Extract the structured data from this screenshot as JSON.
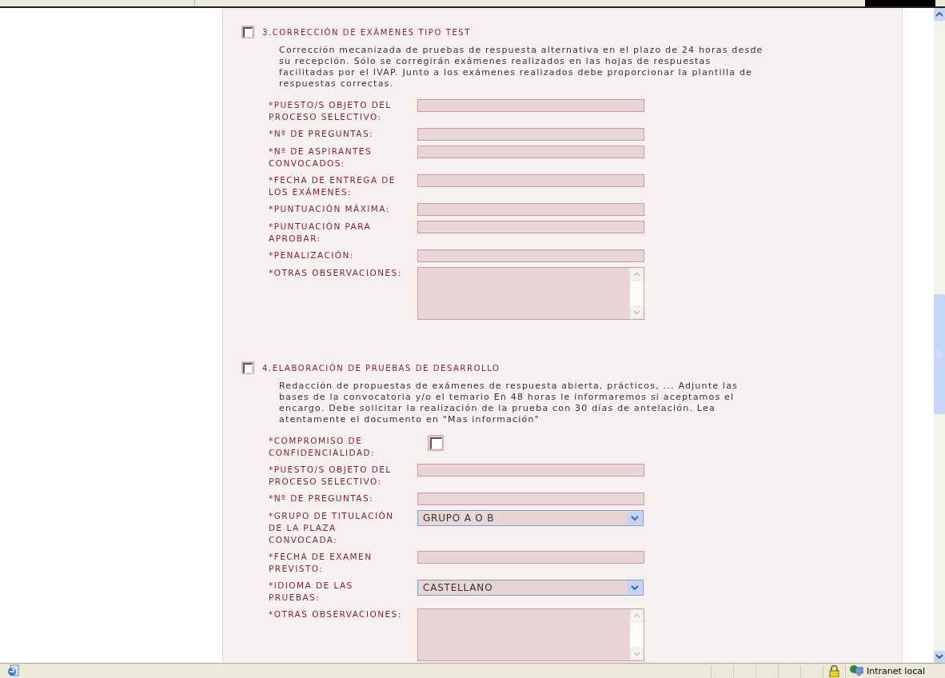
{
  "sections": [
    {
      "title": "3.CORRECCIÓN DE EXÁMENES TIPO TEST",
      "checked": false,
      "description": "Corrección mecanizada de pruebas de respuesta alternativa en el plazo de 24 horas desde su recepción. Sólo se corregirán exámenes realizados en las hojas de respuestas facilitadas por el IVAP. Junto a los exámenes realizados debe proporcionar la plantilla de respuestas correctas.",
      "fields": [
        {
          "kind": "text",
          "label": "*PUESTO/S OBJETO DEL PROCESO SELECTIVO:"
        },
        {
          "kind": "text",
          "label": "*Nº DE PREGUNTAS:"
        },
        {
          "kind": "text",
          "label": "*Nº DE ASPIRANTES CONVOCADOS:"
        },
        {
          "kind": "text",
          "label": "*FECHA DE ENTREGA DE LOS EXÁMENES:"
        },
        {
          "kind": "text",
          "label": "*PUNTUACIÓN MÁXIMA:"
        },
        {
          "kind": "text",
          "label": "*PUNTUACIÓN PARA APROBAR:"
        },
        {
          "kind": "text",
          "label": "*PENALIZACIÓN:"
        },
        {
          "kind": "textarea",
          "label": "*OTRAS OBSERVACIONES:"
        }
      ]
    },
    {
      "title": "4.ELABORACIÓN DE PRUEBAS DE DESARROLLO",
      "checked": false,
      "description": "Redacción de propuestas de exámenes de respuesta abierta, prácticos, ... Adjunte las bases de la convocatoria y/o el temario En 48 horas le informaremos si aceptamos el encargo. Debe solicitar la realización de la prueba con 30 días de antelación. Lea atentamente el documento en \"Mas información\"",
      "fields": [
        {
          "kind": "checkbox",
          "label": "*COMPROMISO DE CONFIDENCIALIDAD:",
          "checked": false
        },
        {
          "kind": "text",
          "label": "*PUESTO/S OBJETO DEL PROCESO SELECTIVO:"
        },
        {
          "kind": "text",
          "label": "*Nº DE PREGUNTAS:"
        },
        {
          "kind": "select",
          "label": "*GRUPO DE TITULACIÓN DE LA PLAZA CONVOCADA:",
          "value": "GRUPO A O B"
        },
        {
          "kind": "text",
          "label": "*FECHA DE EXAMEN PREVISTO:"
        },
        {
          "kind": "select",
          "label": "*IDIOMA DE LAS PRUEBAS:",
          "value": "CASTELLANO"
        },
        {
          "kind": "textarea",
          "label": "*OTRAS OBSERVACIONES:"
        }
      ]
    }
  ],
  "status_bar": {
    "zone": "Intranet local"
  }
}
